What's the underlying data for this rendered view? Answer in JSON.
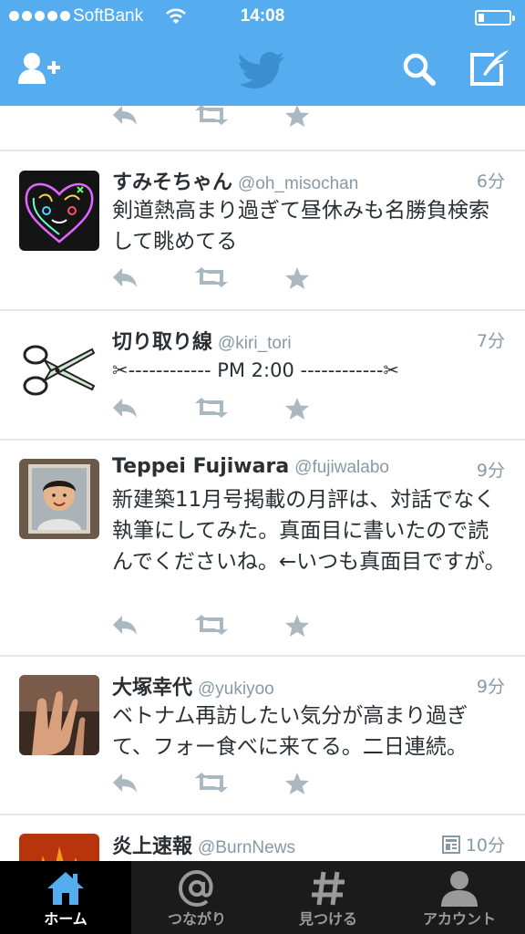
{
  "status": {
    "carrier": "SoftBank",
    "time": "14:08",
    "battery_level": 0.2
  },
  "navbar": {
    "icons": [
      "add-user-icon",
      "twitter-bird-icon",
      "search-icon",
      "compose-icon"
    ],
    "accent": "#55acee"
  },
  "tweets": [
    {
      "name": "",
      "handle": "",
      "time": "",
      "text": ""
    },
    {
      "name": "すみそちゃん",
      "handle": "@oh_misochan",
      "time": "6分",
      "text": "剣道熱高まり過ぎて昼休みも名勝負検索して眺めてる"
    },
    {
      "name": "切り取り線",
      "handle": "@kiri_tori",
      "time": "7分",
      "text": "✂------------ PM 2:00 ------------✂"
    },
    {
      "name": "Teppei Fujiwara",
      "handle": "@fujiwalabo",
      "time": "9分",
      "text": "新建築11月号掲載の月評は、対話でなく執筆にしてみた。真面目に書いたので読んでくださいね。←いつも真面目ですが。"
    },
    {
      "name": "大塚幸代",
      "handle": "@yukiyoo",
      "time": "9分",
      "text": "ベトナム再訪したい気分が高まり過ぎて、フォー食べに来てる。二日連続。"
    },
    {
      "name": "炎上速報",
      "handle": "@BurnNews",
      "time": "10分",
      "text": ""
    }
  ],
  "action_icons": [
    "reply-icon",
    "retweet-icon",
    "favorite-icon"
  ],
  "tabs": [
    {
      "label": "ホーム",
      "icon": "home-icon",
      "active": true
    },
    {
      "label": "つながり",
      "icon": "at-icon",
      "active": false
    },
    {
      "label": "見つける",
      "icon": "hashtag-icon",
      "active": false
    },
    {
      "label": "アカウント",
      "icon": "person-icon",
      "active": false
    }
  ]
}
